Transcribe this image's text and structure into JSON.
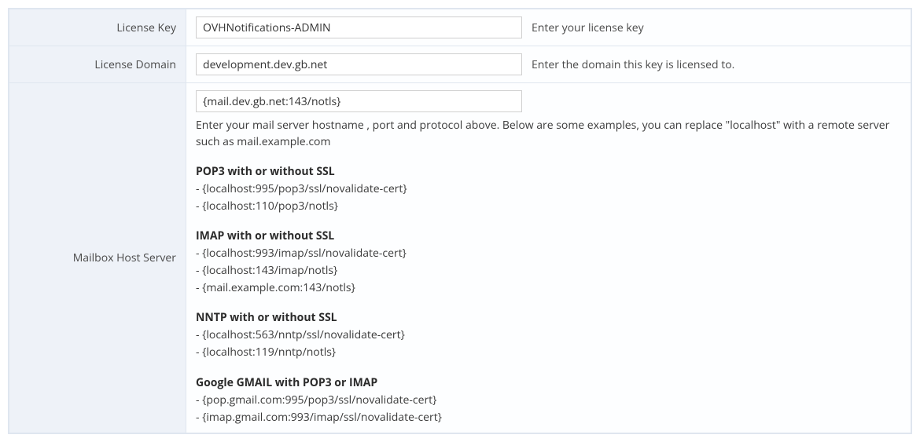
{
  "rows": {
    "licenseKey": {
      "label": "License Key",
      "value": "OVHNotifications-ADMIN",
      "hint": "Enter your license key"
    },
    "licenseDomain": {
      "label": "License Domain",
      "value": "development.dev.gb.net",
      "hint": "Enter the domain this key is licensed to."
    },
    "mailbox": {
      "label": "Mailbox Host Server",
      "value": "{mail.dev.gb.net:143/notls}",
      "help": "Enter your mail server hostname , port and protocol above. Below are some examples, you can replace \"localhost\" with a remote server such as mail.example.com",
      "sections": [
        {
          "title": "POP3 with or without SSL",
          "items": [
            "- {localhost:995/pop3/ssl/novalidate-cert}",
            "- {localhost:110/pop3/notls}"
          ]
        },
        {
          "title": "IMAP with or without SSL",
          "items": [
            "- {localhost:993/imap/ssl/novalidate-cert}",
            "- {localhost:143/imap/notls}",
            "- {mail.example.com:143/notls}"
          ]
        },
        {
          "title": "NNTP with or without SSL",
          "items": [
            "- {localhost:563/nntp/ssl/novalidate-cert}",
            "- {localhost:119/nntp/notls}"
          ]
        },
        {
          "title": "Google GMAIL with POP3 or IMAP",
          "items": [
            "- {pop.gmail.com:995/pop3/ssl/novalidate-cert}",
            "- {imap.gmail.com:993/imap/ssl/novalidate-cert}"
          ]
        }
      ]
    }
  }
}
